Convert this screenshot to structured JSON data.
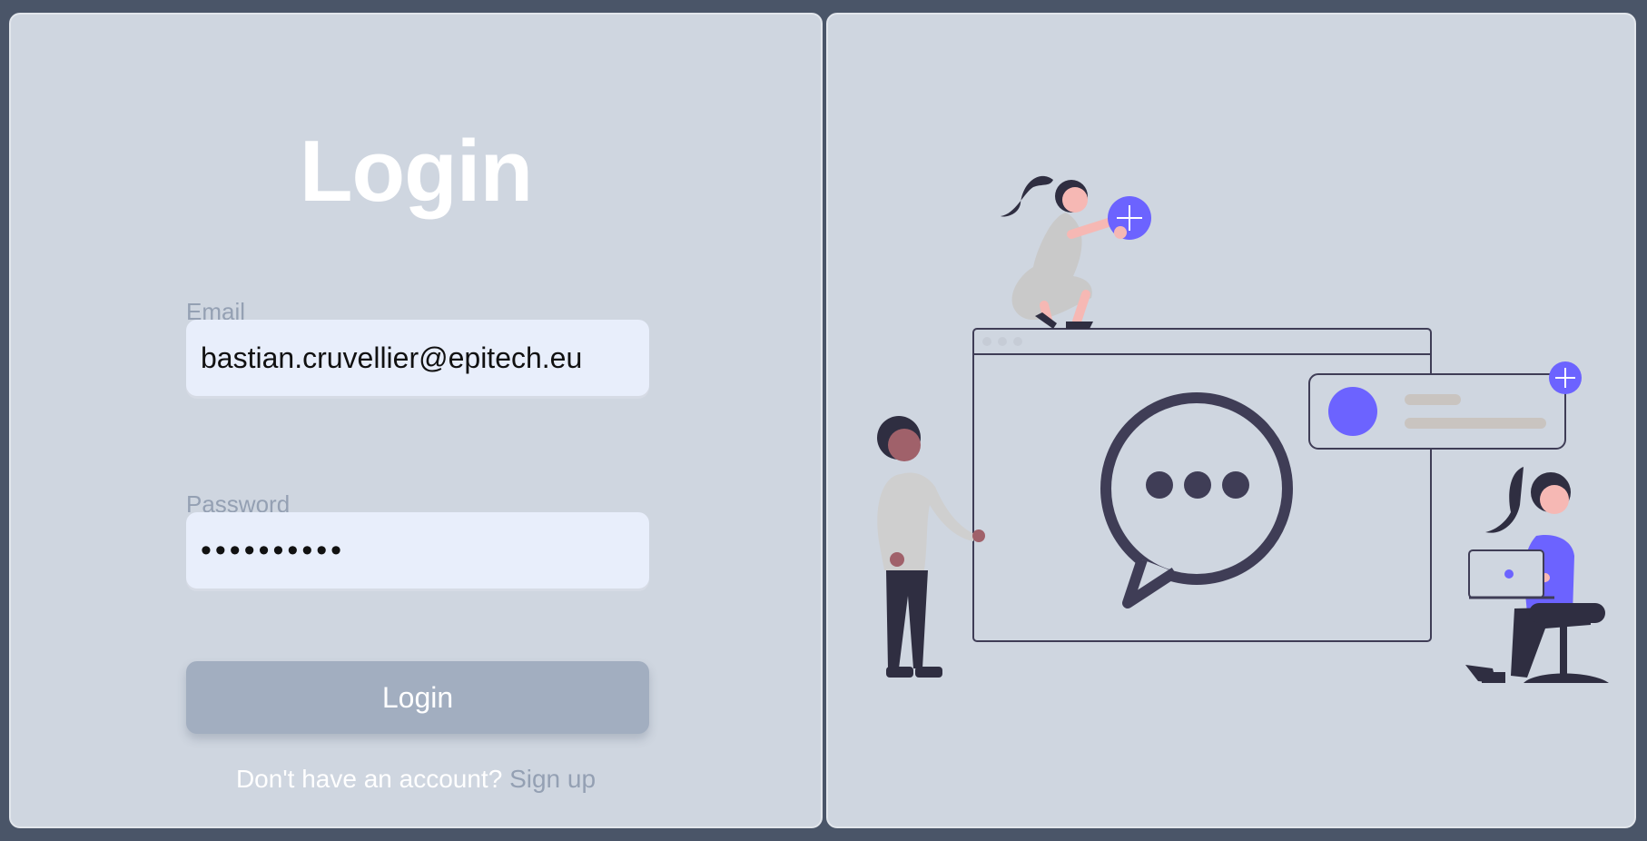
{
  "login": {
    "title": "Login",
    "email_label": "Email",
    "email_value": "bastian.cruvellier@epitech.eu",
    "password_label": "Password",
    "password_value": "••••••••••",
    "button_label": "Login",
    "signup_prompt": "Don't have an account?",
    "signup_link": "Sign up"
  },
  "colors": {
    "background": "#4a5568",
    "panel": "#cfd6e0",
    "input": "#e8eefb",
    "button": "#a2aec0",
    "accent": "#6c63ff",
    "dark": "#3f3d56"
  },
  "illustration": {
    "icons": [
      "plus-icon",
      "chat-bubble-icon",
      "ellipsis-icon",
      "laptop-icon",
      "avatar-circle-icon"
    ]
  }
}
